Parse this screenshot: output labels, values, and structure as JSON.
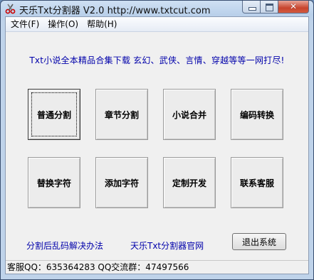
{
  "window": {
    "title": "天乐Txt分割器 V2.0    http://www.txtcut.com",
    "close_glyph": "✕",
    "icon": "scissors-icon"
  },
  "menu": [
    {
      "label": "文件(F)"
    },
    {
      "label": "操作(O)"
    },
    {
      "label": "帮助(H)"
    }
  ],
  "banner": "Txt小说全本精品合集下载 玄幻、武侠、言情、穿越等等一网打尽!",
  "buttons": [
    {
      "label": "普通分割"
    },
    {
      "label": "章节分割"
    },
    {
      "label": "小说合并"
    },
    {
      "label": "编码转换"
    },
    {
      "label": "替换字符"
    },
    {
      "label": "添加字符"
    },
    {
      "label": "定制开发"
    },
    {
      "label": "联系客服"
    }
  ],
  "links": {
    "garbled_fix": "分割后乱码解决办法",
    "official_site": "天乐Txt分割器官网"
  },
  "exit_label": "退出系统",
  "status": "客服QQ：635364283   QQ交流群：47497566",
  "colors": {
    "link": "#0000aa",
    "close_button": "#c7442d",
    "titlebar": "#b9d0ea"
  }
}
